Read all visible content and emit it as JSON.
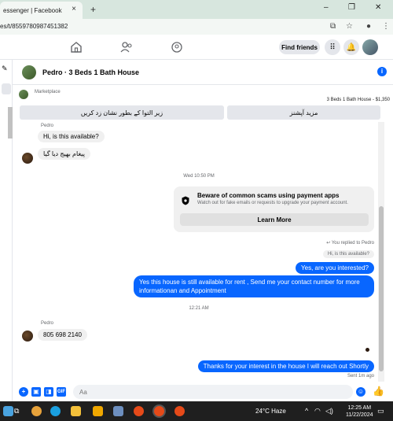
{
  "browser": {
    "tab_title": "essenger | Facebook",
    "tab_close": "×",
    "new_tab": "+",
    "url": "es/t/8559780987451382",
    "win_min": "–",
    "win_max": "❐",
    "win_close": "✕"
  },
  "fb_nav": {
    "find_friends": "Find friends"
  },
  "chat": {
    "title": "Pedro · 3 Beds 1 Bath House",
    "info": "i"
  },
  "marketplace": {
    "label": "Marketplace",
    "item": "3 Beds 1 Bath House - $1,350"
  },
  "actions": {
    "mark_pending": "زیر التوا کے بطور نشان زد کریں",
    "more_options": "مزید آپشنز"
  },
  "messages": {
    "sender_top": "Pedro",
    "msg1": "Hi, is this available?",
    "msg2": "پیغام بھیج دیا گیا",
    "timestamp1": "Wed 10:50 PM",
    "scam_title": "Beware of common scams using payment apps",
    "scam_desc": "Watch out for fake emails or requests to upgrade your payment account.",
    "learn_more": "Learn More",
    "replied_to": "You replied to Pedro",
    "quoted": "Hi, is this available?",
    "out1": "Yes, are you interested?",
    "out2_line1": "Yes this house is still available for rent , Send me your contact number for more",
    "out2_line2": "informationan and Appointment",
    "timestamp2": "12:21 AM",
    "sender_bottom": "Pedro",
    "msg3": "805 698 2140",
    "out3": "Thanks for your interest in the house I will reach out Shortly",
    "sent_status": "Sent 1m ago"
  },
  "composer": {
    "placeholder": "Aa"
  },
  "taskbar": {
    "weather": "24°C  Haze",
    "time": "12:25 AM",
    "date": "11/22/2024"
  }
}
